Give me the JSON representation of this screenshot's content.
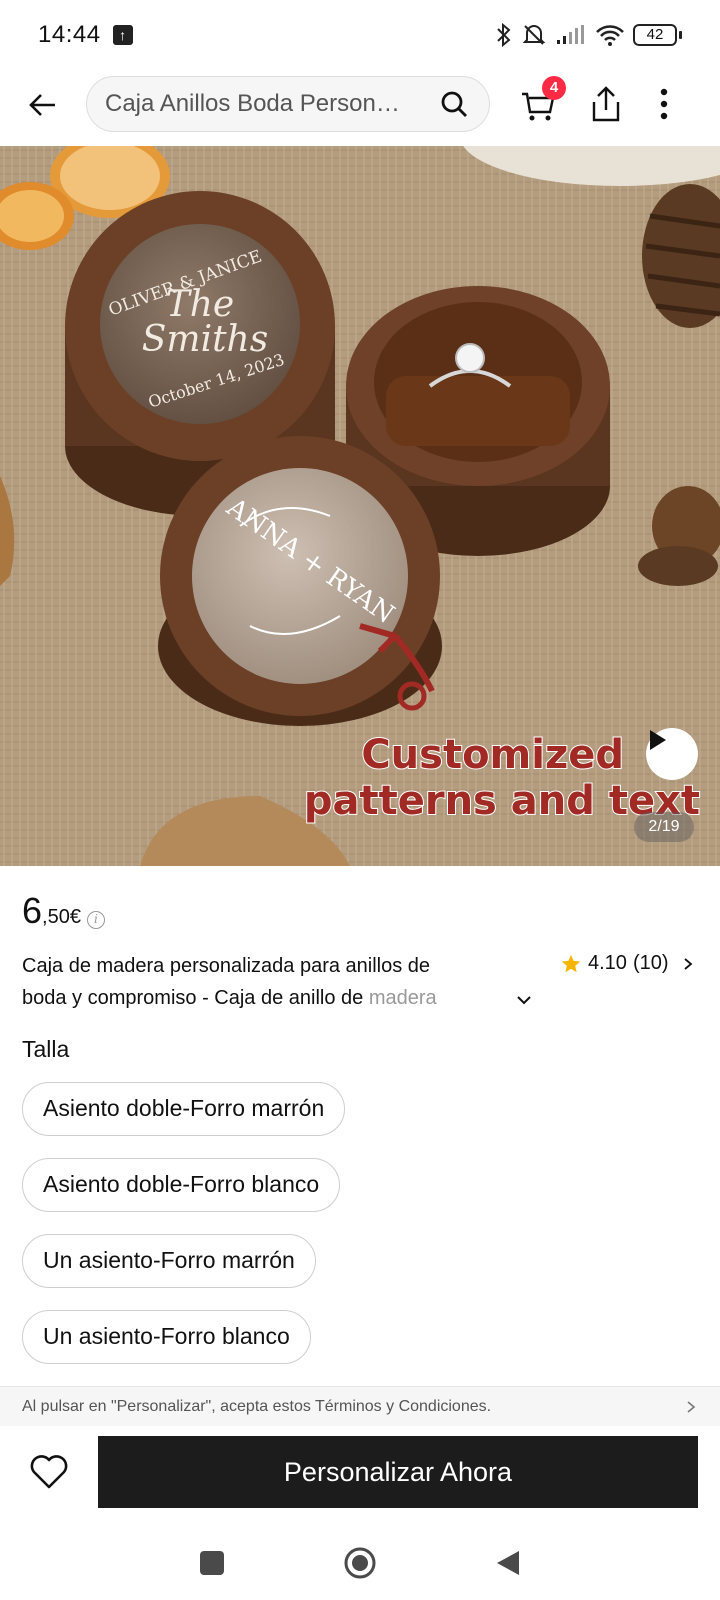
{
  "status_bar": {
    "time": "14:44",
    "battery": "42"
  },
  "header": {
    "search_text": "Caja Anillos Boda Person…",
    "cart_count": "4"
  },
  "gallery": {
    "caption_line1": "Customized",
    "caption_line2": "patterns and text",
    "page_indicator": "2/19",
    "engraving_left": [
      "OLIVER & JANICE",
      "The",
      "Smiths",
      "October 14, 2023"
    ],
    "engraving_front": [
      "ANNA + RYAN"
    ]
  },
  "product": {
    "price_int": "6",
    "price_dec": ",50€",
    "title_line1": "Caja de madera personalizada para anillos de",
    "title_line2": "boda y compromiso - Caja de anillo de ",
    "title_fade": "madera",
    "rating": "4.10",
    "reviews": "(10)"
  },
  "size": {
    "label": "Talla",
    "options": [
      "Asiento doble-Forro marrón",
      "Asiento doble-Forro blanco",
      "Un asiento-Forro marrón",
      "Un asiento-Forro blanco"
    ]
  },
  "terms": "Al pulsar en \"Personalizar\", acepta estos Términos y Condiciones.",
  "cta": "Personalizar Ahora",
  "colors": {
    "accent_badge": "#ff2a44",
    "cta_bg": "#1c1c1c",
    "star": "#f7b500",
    "caption": "#a12a25"
  }
}
